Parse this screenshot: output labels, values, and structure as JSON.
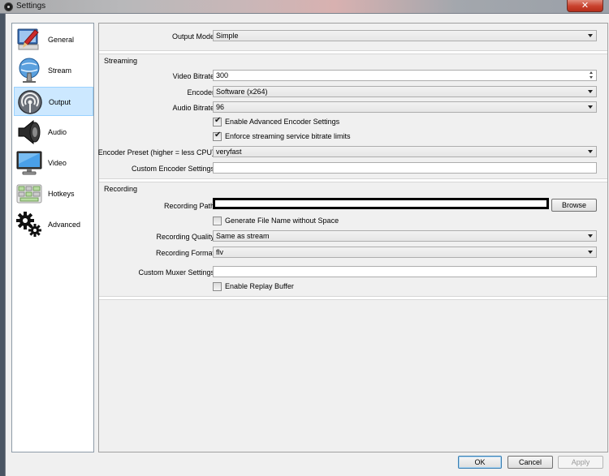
{
  "window": {
    "title": "Settings",
    "close_label": "✕"
  },
  "sidebar": {
    "items": [
      {
        "label": "General",
        "icon": "general-icon"
      },
      {
        "label": "Stream",
        "icon": "stream-icon"
      },
      {
        "label": "Output",
        "icon": "output-icon",
        "selected": true
      },
      {
        "label": "Audio",
        "icon": "speaker-icon"
      },
      {
        "label": "Video",
        "icon": "monitor-icon"
      },
      {
        "label": "Hotkeys",
        "icon": "keyboard-icon"
      },
      {
        "label": "Advanced",
        "icon": "gears-icon"
      }
    ]
  },
  "output": {
    "output_mode_label": "Output Mode",
    "output_mode_value": "Simple",
    "streaming": {
      "heading": "Streaming",
      "video_bitrate_label": "Video Bitrate",
      "video_bitrate_value": "300",
      "encoder_label": "Encoder",
      "encoder_value": "Software (x264)",
      "audio_bitrate_label": "Audio Bitrate",
      "audio_bitrate_value": "96",
      "advanced_encoder_label": "Enable Advanced Encoder Settings",
      "advanced_encoder_checked": true,
      "enforce_limits_label": "Enforce streaming service bitrate limits",
      "enforce_limits_checked": true,
      "preset_label": "Encoder Preset (higher = less CPU)",
      "preset_value": "veryfast",
      "custom_encoder_label": "Custom Encoder Settings",
      "custom_encoder_value": ""
    },
    "recording": {
      "heading": "Recording",
      "path_label": "Recording Path",
      "path_value": "",
      "browse_label": "Browse",
      "no_space_label": "Generate File Name without Space",
      "no_space_checked": false,
      "quality_label": "Recording Quality",
      "quality_value": "Same as stream",
      "format_label": "Recording Format",
      "format_value": "flv",
      "muxer_label": "Custom Muxer Settings",
      "muxer_value": "",
      "replay_label": "Enable Replay Buffer",
      "replay_checked": false
    }
  },
  "footer": {
    "ok_label": "OK",
    "cancel_label": "Cancel",
    "apply_label": "Apply"
  },
  "colors": {
    "selected_nav": "#cce8ff",
    "close_button": "#c8402c",
    "panel": "#f0f0f0"
  }
}
